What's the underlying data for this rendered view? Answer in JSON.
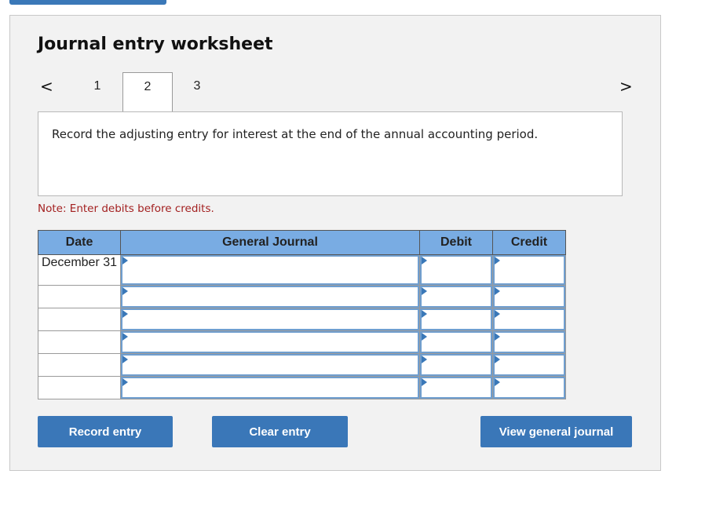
{
  "header": {
    "title": "Journal entry worksheet"
  },
  "tabs": [
    {
      "label": "1",
      "active": false
    },
    {
      "label": "2",
      "active": true
    },
    {
      "label": "3",
      "active": false
    }
  ],
  "nav": {
    "prev_icon": "chevron-left",
    "next_icon": "chevron-right",
    "prev_glyph": "<",
    "next_glyph": ">"
  },
  "instruction": "Record the adjusting entry for interest at the end of the annual accounting period.",
  "note": "Note: Enter debits before credits.",
  "table": {
    "columns": [
      "Date",
      "General Journal",
      "Debit",
      "Credit"
    ],
    "rows": [
      {
        "date": "December 31",
        "account": "",
        "debit": "",
        "credit": ""
      },
      {
        "date": "",
        "account": "",
        "debit": "",
        "credit": ""
      },
      {
        "date": "",
        "account": "",
        "debit": "",
        "credit": ""
      },
      {
        "date": "",
        "account": "",
        "debit": "",
        "credit": ""
      },
      {
        "date": "",
        "account": "",
        "debit": "",
        "credit": ""
      },
      {
        "date": "",
        "account": "",
        "debit": "",
        "credit": ""
      }
    ]
  },
  "buttons": {
    "record": "Record entry",
    "clear": "Clear entry",
    "view": "View general journal"
  },
  "colors": {
    "accent": "#3a77b8",
    "header_bg": "#79ace3",
    "note": "#a32020"
  }
}
